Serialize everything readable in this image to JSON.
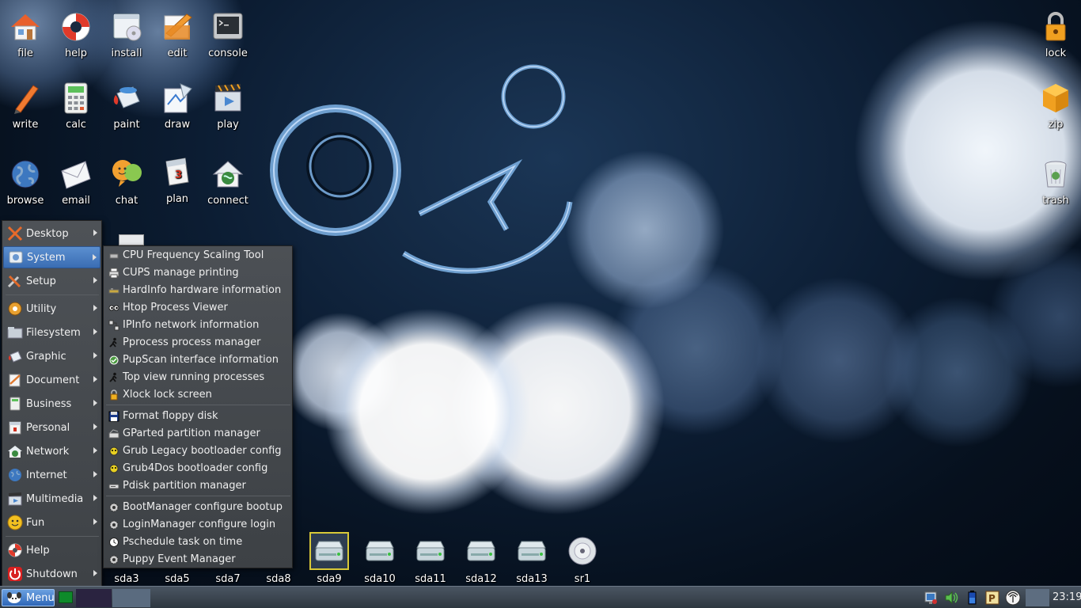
{
  "desktop_icons": {
    "file": "file",
    "help": "help",
    "install": "install",
    "edit": "edit",
    "console": "console",
    "write": "write",
    "calc": "calc",
    "paint": "paint",
    "draw": "draw",
    "play": "play",
    "browse": "browse",
    "email": "email",
    "chat": "chat",
    "plan": "plan",
    "connect": "connect",
    "lock": "lock",
    "zip": "zip",
    "trash": "trash"
  },
  "main_menu": {
    "items": [
      {
        "label": "Desktop",
        "icon": "x-icon",
        "submenu": true
      },
      {
        "label": "System",
        "icon": "system-icon",
        "submenu": true,
        "active": true
      },
      {
        "label": "Setup",
        "icon": "tools-icon",
        "submenu": true
      },
      {
        "label": "Utility",
        "icon": "utility-icon",
        "submenu": true
      },
      {
        "label": "Filesystem",
        "icon": "folder-icon",
        "submenu": true
      },
      {
        "label": "Graphic",
        "icon": "paint-icon",
        "submenu": true
      },
      {
        "label": "Document",
        "icon": "document-icon",
        "submenu": true
      },
      {
        "label": "Business",
        "icon": "calculator-icon",
        "submenu": true
      },
      {
        "label": "Personal",
        "icon": "calendar-icon",
        "submenu": true
      },
      {
        "label": "Network",
        "icon": "network-icon",
        "submenu": true
      },
      {
        "label": "Internet",
        "icon": "globe-icon",
        "submenu": true
      },
      {
        "label": "Multimedia",
        "icon": "multimedia-icon",
        "submenu": true
      },
      {
        "label": "Fun",
        "icon": "smiley-icon",
        "submenu": true
      },
      {
        "label": "Help",
        "icon": "lifebuoy-icon",
        "submenu": false
      },
      {
        "label": "Shutdown",
        "icon": "power-icon",
        "submenu": true
      }
    ]
  },
  "system_menu": {
    "items": [
      {
        "label": "CPU Frequency Scaling Tool",
        "icon": "cpu-icon"
      },
      {
        "label": "CUPS manage printing",
        "icon": "printer-icon"
      },
      {
        "label": "HardInfo hardware information",
        "icon": "hardware-icon"
      },
      {
        "label": "Htop Process Viewer",
        "icon": "eyes-icon"
      },
      {
        "label": "IPInfo network information",
        "icon": "network-info-icon"
      },
      {
        "label": "Pprocess process manager",
        "icon": "runner-icon"
      },
      {
        "label": "PupScan interface information",
        "icon": "scan-icon"
      },
      {
        "label": "Top view running processes",
        "icon": "runner-icon"
      },
      {
        "label": "Xlock lock screen",
        "icon": "lock-icon"
      },
      {
        "label": "Format floppy disk",
        "icon": "floppy-icon"
      },
      {
        "label": "GParted partition manager",
        "icon": "gparted-icon"
      },
      {
        "label": "Grub Legacy bootloader config",
        "icon": "grub-icon"
      },
      {
        "label": "Grub4Dos bootloader config",
        "icon": "grub-icon"
      },
      {
        "label": "Pdisk partition manager",
        "icon": "disk-icon"
      },
      {
        "label": "BootManager configure bootup",
        "icon": "gear-icon"
      },
      {
        "label": "LoginManager configure login",
        "icon": "gear-icon"
      },
      {
        "label": "Pschedule task on time",
        "icon": "clock-icon"
      },
      {
        "label": "Puppy Event Manager",
        "icon": "gear-icon"
      }
    ]
  },
  "drives": [
    "sda3",
    "sda5",
    "sda7",
    "sda8",
    "sda9",
    "sda10",
    "sda11",
    "sda12",
    "sda13",
    "sr1"
  ],
  "selected_drive": "sda9",
  "taskbar": {
    "menu_label": "Menu",
    "clock": "23:19"
  },
  "colors": {
    "menu_bg": "#474b50",
    "menu_highlight": "#4a7ec3",
    "taskbar_bg": "#3a4450",
    "selection_outline": "#d8c838"
  }
}
